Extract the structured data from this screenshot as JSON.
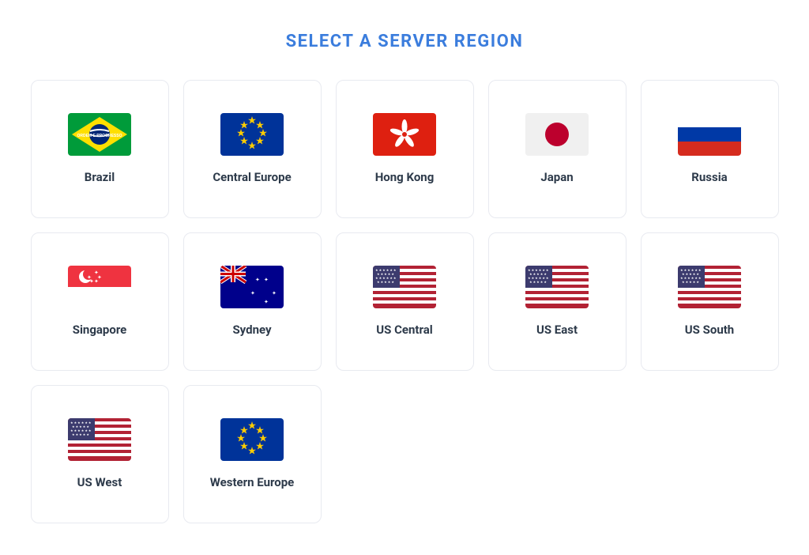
{
  "page": {
    "title": "SELECT A SERVER REGION"
  },
  "regions": [
    {
      "id": "brazil",
      "label": "Brazil"
    },
    {
      "id": "central-europe",
      "label": "Central Europe"
    },
    {
      "id": "hong-kong",
      "label": "Hong Kong"
    },
    {
      "id": "japan",
      "label": "Japan"
    },
    {
      "id": "russia",
      "label": "Russia"
    },
    {
      "id": "singapore",
      "label": "Singapore"
    },
    {
      "id": "sydney",
      "label": "Sydney"
    },
    {
      "id": "us-central",
      "label": "US Central"
    },
    {
      "id": "us-east",
      "label": "US East"
    },
    {
      "id": "us-south",
      "label": "US South"
    },
    {
      "id": "us-west",
      "label": "US West"
    },
    {
      "id": "western-europe",
      "label": "Western Europe"
    }
  ]
}
